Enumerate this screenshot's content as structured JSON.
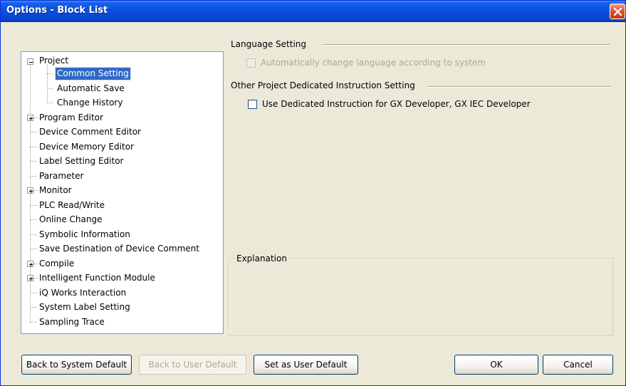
{
  "window": {
    "title": "Options - Block List"
  },
  "tree": {
    "items": [
      {
        "label": "Project",
        "expander": "minus"
      },
      {
        "label": "Common Setting",
        "selected": true
      },
      {
        "label": "Automatic Save"
      },
      {
        "label": "Change History"
      },
      {
        "label": "Program Editor",
        "expander": "plus"
      },
      {
        "label": "Device Comment Editor"
      },
      {
        "label": "Device Memory Editor"
      },
      {
        "label": "Label Setting Editor"
      },
      {
        "label": "Parameter"
      },
      {
        "label": "Monitor",
        "expander": "plus"
      },
      {
        "label": "PLC Read/Write"
      },
      {
        "label": "Online Change"
      },
      {
        "label": "Symbolic Information"
      },
      {
        "label": "Save Destination of Device Comment"
      },
      {
        "label": "Compile",
        "expander": "plus"
      },
      {
        "label": "Intelligent Function Module",
        "expander": "plus"
      },
      {
        "label": "iQ Works Interaction"
      },
      {
        "label": "System Label Setting"
      },
      {
        "label": "Sampling Trace"
      }
    ]
  },
  "language_setting": {
    "heading": "Language Setting",
    "auto_change_label": "Automatically change language according to system",
    "auto_change_checked": false,
    "auto_change_enabled": false
  },
  "dedicated_instruction": {
    "heading": "Other Project Dedicated Instruction Setting",
    "use_label": "Use Dedicated Instruction for GX Developer, GX IEC Developer",
    "use_checked": false
  },
  "explanation": {
    "legend": "Explanation"
  },
  "buttons": {
    "back_system": "Back to System Default",
    "back_user": "Back to User Default",
    "set_user": "Set as User Default",
    "ok": "OK",
    "cancel": "Cancel"
  },
  "colors": {
    "titlebar": "#0a52de",
    "selection": "#316ac5",
    "dialog_bg": "#ece9d8",
    "close": "#e0553a"
  },
  "icons": {
    "close": "close-icon",
    "expand": "plus-icon",
    "collapse": "minus-icon"
  }
}
